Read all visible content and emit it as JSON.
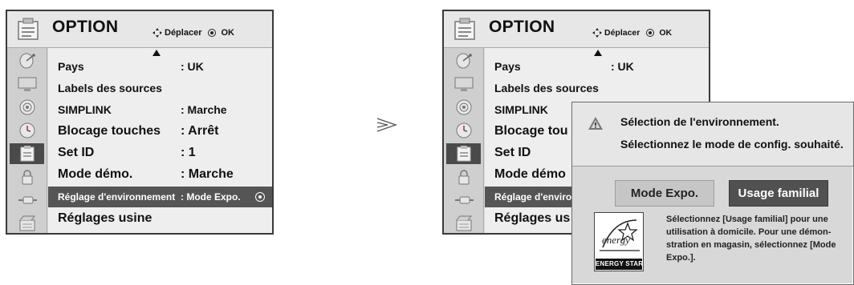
{
  "left_menu": {
    "title": "OPTION",
    "nav_hint": "Déplacer",
    "ok_hint": "OK",
    "rows": [
      {
        "label": "Pays",
        "value": ": UK"
      },
      {
        "label": "Labels des sources",
        "value": ""
      },
      {
        "label": "SIMPLINK",
        "value": ": Marche"
      },
      {
        "label": "Blocage touches",
        "value": ": Arrêt"
      },
      {
        "label": "Set ID",
        "value": ": 1"
      },
      {
        "label": "Mode démo.",
        "value": ": Marche"
      },
      {
        "label": "Réglage d'environnement",
        "value": ": Mode Expo."
      },
      {
        "label": "Réglages usine",
        "value": ""
      }
    ]
  },
  "right_menu": {
    "title": "OPTION",
    "nav_hint": "Déplacer",
    "ok_hint": "OK",
    "rows": [
      {
        "label": "Pays",
        "value": ": UK"
      },
      {
        "label": "Labels des sources",
        "value": ""
      },
      {
        "label": "SIMPLINK",
        "value": ""
      },
      {
        "label": "Blocage tou",
        "value": ""
      },
      {
        "label": "Set ID",
        "value": ""
      },
      {
        "label": "Mode démo",
        "value": ""
      },
      {
        "label": "Réglage d'enviro",
        "value": ""
      },
      {
        "label": "Réglages us",
        "value": ""
      }
    ]
  },
  "popup": {
    "line1": "Sélection de l'environnement.",
    "line2": "Sélectionnez le mode de config. souhaité.",
    "btn_expo": "Mode Expo.",
    "btn_usage": "Usage familial",
    "energy_label": "ENERGY STAR",
    "energy_script": "energy",
    "description": "Sélectionnez [Usage familial] pour une utilisation à domicile. Pour une démon- stration en magasin, sélectionnez [Mode Expo.]."
  },
  "icons": {
    "sidebar": [
      "satellite-dish-icon",
      "monitor-icon",
      "audio-icon",
      "clock-icon",
      "option-icon",
      "lock-icon",
      "input-icon",
      "media-icon"
    ],
    "header": "option-icon",
    "popup": "warning-icon"
  },
  "colors": {
    "selected_row": "#555555",
    "usage_button": "#515151",
    "expo_button": "#c6c6c6"
  }
}
